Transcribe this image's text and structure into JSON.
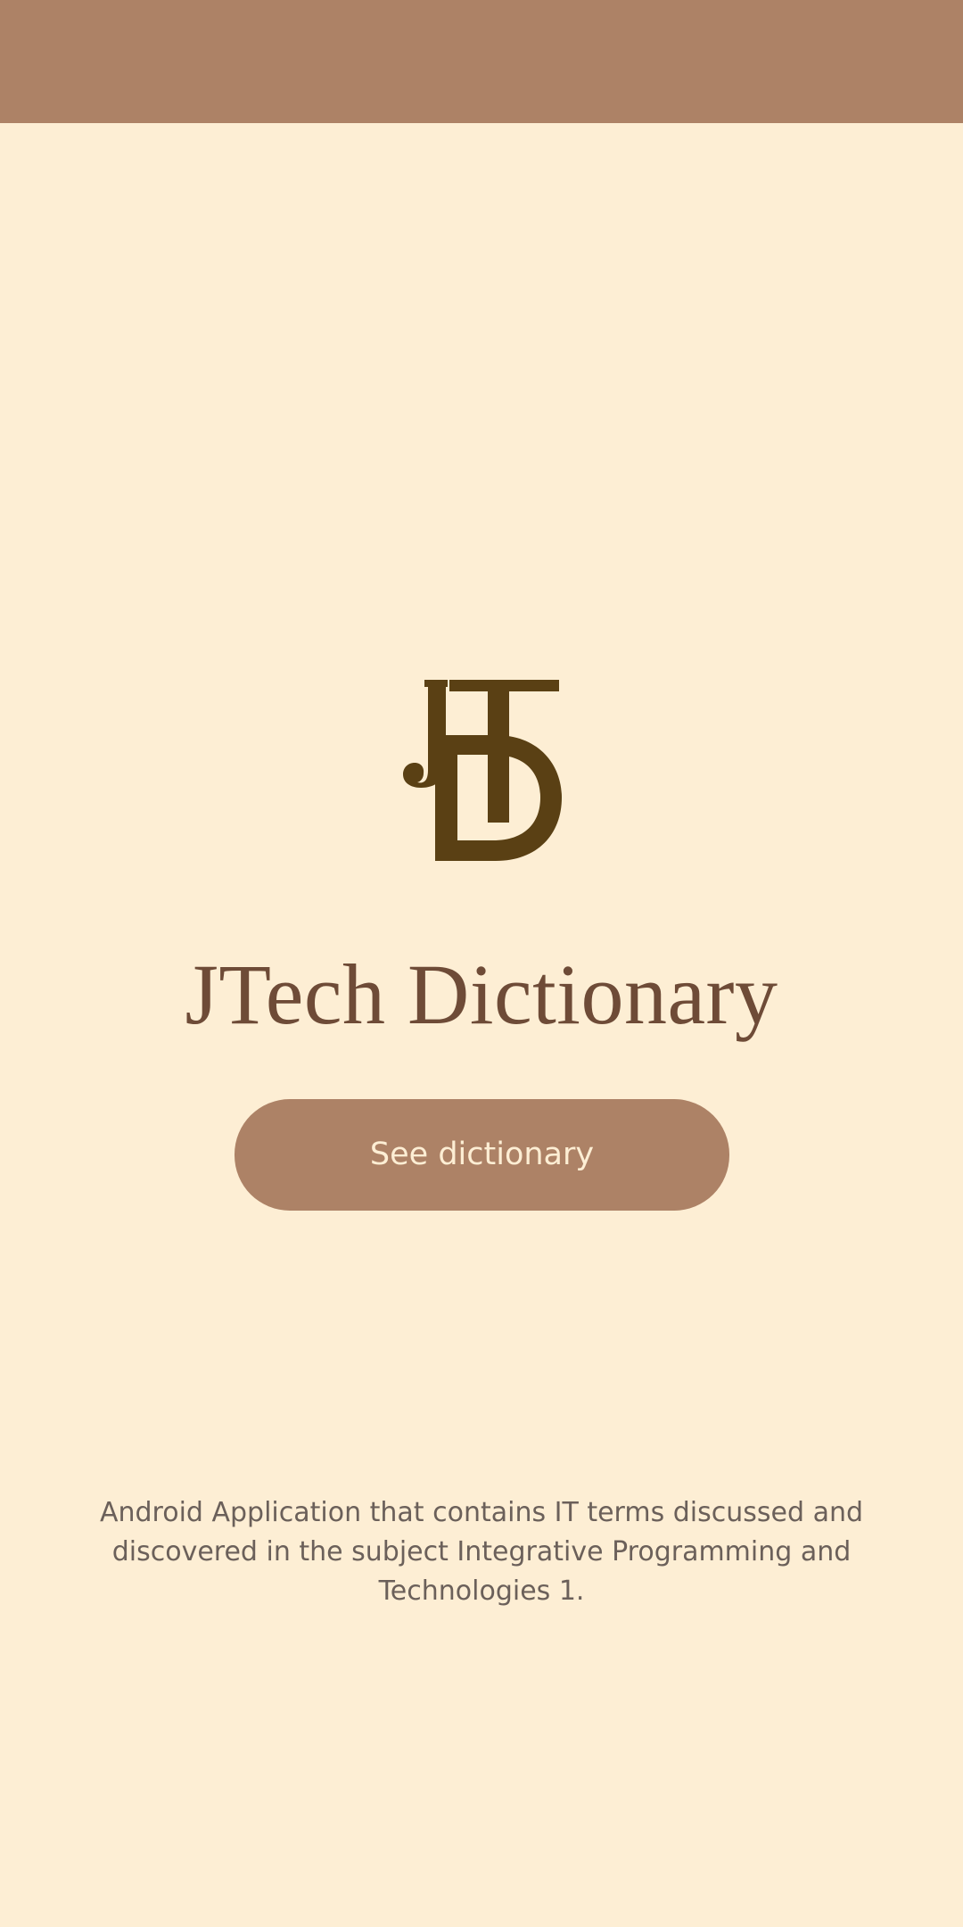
{
  "app": {
    "title": "JTech Dictionary",
    "logo_text": "JTD",
    "logo_icon": "jtd-monogram-logo"
  },
  "actions": {
    "see_dictionary_label": "See dictionary"
  },
  "footer": {
    "description": "Android Application that contains IT terms discussed and discovered in the subject Integrative Programming and Technologies 1."
  },
  "colors": {
    "background": "#FDEED4",
    "top_bar": "#AD8266",
    "button": "#AD8266",
    "button_text": "#FDEED4",
    "logo": "#5A4014",
    "title": "#6E4B37",
    "description": "#6B605A"
  }
}
